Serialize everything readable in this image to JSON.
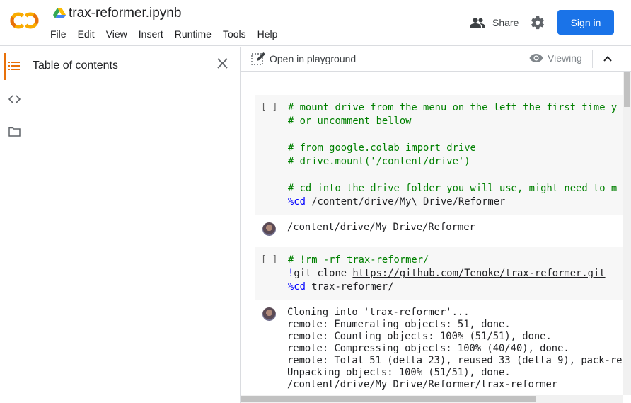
{
  "app": {
    "title": "trax-reformer.ipynb",
    "menu": [
      "File",
      "Edit",
      "View",
      "Insert",
      "Runtime",
      "Tools",
      "Help"
    ],
    "share_label": "Share",
    "signin_label": "Sign in",
    "colors": {
      "accent": "#1a73e8",
      "logo_orange": "#f9ab00",
      "logo_dark_orange": "#e8710a"
    }
  },
  "sidebar": {
    "title": "Table of contents",
    "icons": [
      "toc-icon",
      "code-icon",
      "folder-icon"
    ]
  },
  "toolbar": {
    "playground_label": "Open in playground",
    "viewing_label": "Viewing"
  },
  "cells": [
    {
      "bracket": "[ ]",
      "lines": [
        [
          {
            "t": "cm",
            "v": "# mount drive from the menu on the left the first time y"
          }
        ],
        [
          {
            "t": "cm",
            "v": "# or uncomment bellow"
          }
        ],
        [],
        [
          {
            "t": "cm",
            "v": "# from google.colab import drive"
          }
        ],
        [
          {
            "t": "cm",
            "v": "# drive.mount('/content/drive')"
          }
        ],
        [],
        [
          {
            "t": "cm",
            "v": "# cd into the drive folder you will use, might need to m"
          }
        ],
        [
          {
            "t": "mg",
            "v": "%cd"
          },
          {
            "t": "tx",
            "v": " /content/drive/My\\ Drive/Reformer"
          }
        ]
      ],
      "output": [
        "/content/drive/My Drive/Reformer"
      ]
    },
    {
      "bracket": "[ ]",
      "lines": [
        [
          {
            "t": "cm",
            "v": "# !rm -rf trax-reformer/"
          }
        ],
        [
          {
            "t": "mg",
            "v": "!"
          },
          {
            "t": "tx",
            "v": "git clone "
          },
          {
            "t": "url",
            "v": "https://github.com/Tenoke/trax-reformer.git"
          }
        ],
        [
          {
            "t": "mg",
            "v": "%cd"
          },
          {
            "t": "tx",
            "v": " trax-reformer/"
          }
        ]
      ],
      "output": [
        "Cloning into 'trax-reformer'...",
        "remote: Enumerating objects: 51, done.",
        "remote: Counting objects: 100% (51/51), done.",
        "remote: Compressing objects: 100% (40/40), done.",
        "remote: Total 51 (delta 23), reused 33 (delta 9), pack-re",
        "Unpacking objects: 100% (51/51), done.",
        "/content/drive/My Drive/Reformer/trax-reformer"
      ]
    }
  ]
}
